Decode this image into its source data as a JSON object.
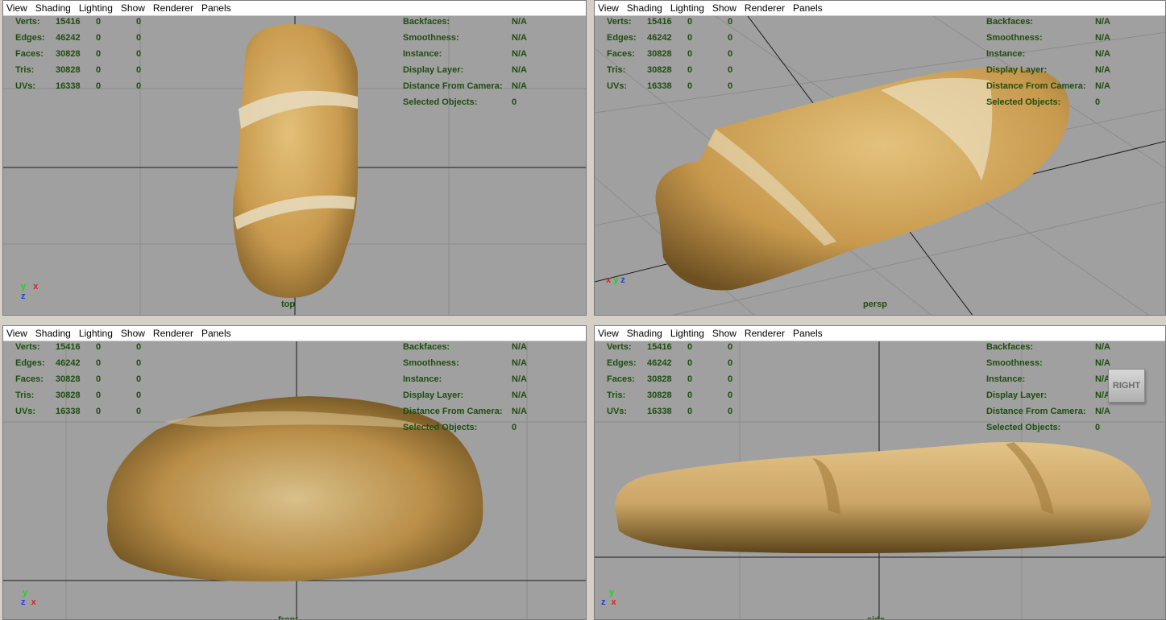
{
  "menu": [
    "View",
    "Shading",
    "Lighting",
    "Show",
    "Renderer",
    "Panels"
  ],
  "stats": [
    {
      "label": "Verts:",
      "v1": "15416",
      "v2": "0",
      "v3": "0"
    },
    {
      "label": "Edges:",
      "v1": "46242",
      "v2": "0",
      "v3": "0"
    },
    {
      "label": "Faces:",
      "v1": "30828",
      "v2": "0",
      "v3": "0"
    },
    {
      "label": "Tris:",
      "v1": "30828",
      "v2": "0",
      "v3": "0"
    },
    {
      "label": "UVs:",
      "v1": "16338",
      "v2": "0",
      "v3": "0"
    }
  ],
  "info": [
    {
      "label": "Backfaces:",
      "value": "N/A"
    },
    {
      "label": "Smoothness:",
      "value": "N/A"
    },
    {
      "label": "Instance:",
      "value": "N/A"
    },
    {
      "label": "Display Layer:",
      "value": "N/A"
    },
    {
      "label": "Distance From Camera:",
      "value": "N/A"
    },
    {
      "label": "Selected Objects:",
      "value": "0"
    }
  ],
  "viewports": {
    "top": {
      "camera": "top",
      "axes": {
        "a": "y",
        "b": "x",
        "c": "z"
      }
    },
    "persp": {
      "camera": "persp",
      "axes": {
        "a": "x",
        "b": "y",
        "c": "z"
      }
    },
    "front": {
      "camera": "front",
      "axes": {
        "a": "y",
        "b": "z",
        "c": "x"
      }
    },
    "side": {
      "camera": "side",
      "axes": {
        "a": "y",
        "b": "z",
        "c": "x"
      }
    }
  },
  "viewcube_label": "RIGHT",
  "colors": {
    "viewport_bg": "#a0a0a0",
    "grid": "#8c8c8c",
    "hud_text": "#1e4d10",
    "bread_light": "#d9b56a",
    "bread_dark": "#8c6a2e"
  }
}
